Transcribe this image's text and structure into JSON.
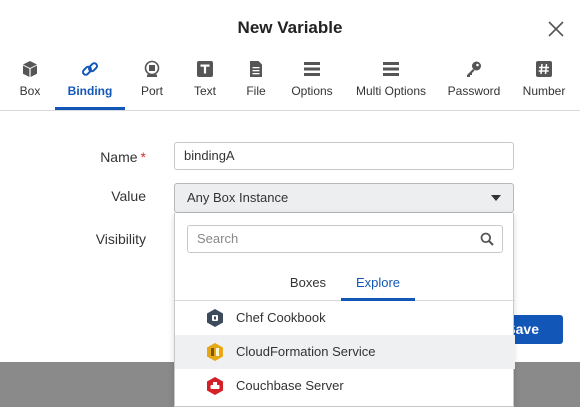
{
  "dialog": {
    "title": "New Variable"
  },
  "tabs": [
    {
      "label": "Box",
      "icon": "box-icon"
    },
    {
      "label": "Binding",
      "icon": "link-icon",
      "active": true
    },
    {
      "label": "Port",
      "icon": "port-icon"
    },
    {
      "label": "Text",
      "icon": "text-icon"
    },
    {
      "label": "File",
      "icon": "file-icon"
    },
    {
      "label": "Options",
      "icon": "list-icon"
    },
    {
      "label": "Multi Options",
      "icon": "list-icon"
    },
    {
      "label": "Password",
      "icon": "key-icon"
    },
    {
      "label": "Number",
      "icon": "hash-icon"
    }
  ],
  "form": {
    "name_label": "Name",
    "required_mark": "*",
    "name_value": "bindingA",
    "value_label": "Value",
    "value_selected": "Any Box Instance",
    "visibility_label": "Visibility"
  },
  "dropdown": {
    "search_placeholder": "Search",
    "tabs": [
      {
        "label": "Boxes"
      },
      {
        "label": "Explore",
        "active": true
      }
    ],
    "items": [
      {
        "label": "Chef Cookbook",
        "icon": "chef-icon",
        "color": "#3c4a5c"
      },
      {
        "label": "CloudFormation Service",
        "icon": "cloudformation-icon",
        "color": "#e6a817"
      },
      {
        "label": "Couchbase Server",
        "icon": "couchbase-icon",
        "color": "#d42027"
      }
    ]
  },
  "footer": {
    "save_label": "Save"
  },
  "colors": {
    "accent": "#1257b8"
  }
}
